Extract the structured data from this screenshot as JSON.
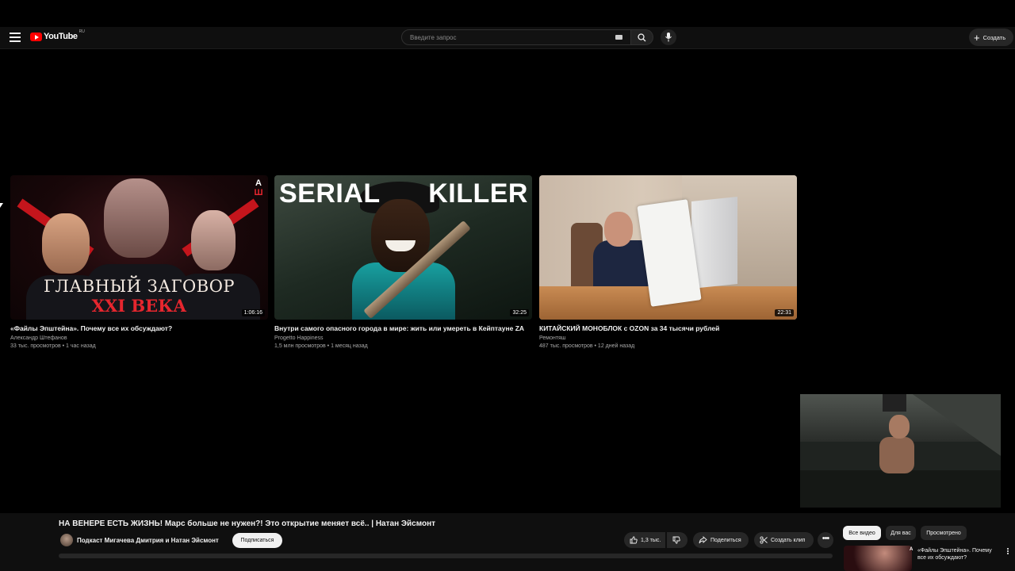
{
  "header": {
    "logo_text": "YouTube",
    "country_code": "RU",
    "search_placeholder": "Введите запрос",
    "create_label": "Создать"
  },
  "videos": [
    {
      "title": "«Файлы Эпштейна». Почему все их обсуждают?",
      "channel": "Александр Штефанов",
      "meta": "33 тыс. просмотров • 1 час назад",
      "duration": "1:06:16",
      "thumb_line1": "ГЛАВНЫЙ ЗАГОВОР",
      "thumb_line2": "XXI ВЕКА",
      "thumb_badge_top": "А",
      "thumb_badge_bottom": "Ш"
    },
    {
      "title": "Внутри самого опасного города в мире: жить или умереть в Кейптауне ZA",
      "channel": "Progetto Happiness",
      "meta": "1,5 млн просмотров • 1 месяц назад",
      "duration": "32:25",
      "thumb_word1": "SERIAL",
      "thumb_word2": "KILLER"
    },
    {
      "title": "КИТАЙСКИЙ МОНОБЛОК с OZON за 34 тысячи рублей",
      "channel": "Ремонтяш",
      "meta": "487 тыс. просмотров • 12 дней назад",
      "duration": "22:31"
    }
  ],
  "now_playing": {
    "title": "НА ВЕНЕРЕ ЕСТЬ ЖИЗНЬ! Марс больше не нужен?! Это открытие меняет всё.. | Натан Эйсмонт",
    "channel": "Подкаст Мигачева Дмитрия и Натан Эйсмонт",
    "subscribe_label": "Подписаться",
    "likes": "1,3 тыс.",
    "share_label": "Поделиться",
    "clip_label": "Создать клип",
    "more_label": "•••"
  },
  "chips": [
    "Все видео",
    "Для вас",
    "Просмотрено"
  ],
  "recommendation": {
    "title": "«Файлы Эпштейна». Почему все их обсуждают?",
    "logo": "А"
  },
  "colors": {
    "background": "#000000",
    "masthead": "#0f0f0f",
    "brand_red": "#ff0000",
    "text": "#f1f1f1",
    "secondary_text": "#aaaaaa"
  }
}
